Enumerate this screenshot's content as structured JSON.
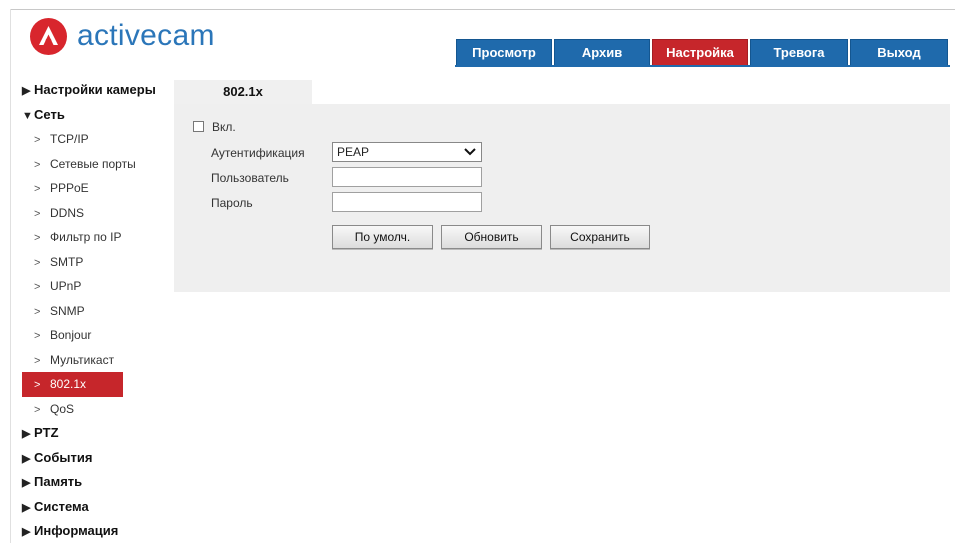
{
  "brand": {
    "name": "activecam",
    "logo_color": "#d8262d",
    "text_color": "#2b76b9"
  },
  "nav": {
    "tabs": [
      {
        "label": "Просмотр",
        "active": false
      },
      {
        "label": "Архив",
        "active": false
      },
      {
        "label": "Настройка",
        "active": true
      },
      {
        "label": "Тревога",
        "active": false
      },
      {
        "label": "Выход",
        "active": false
      }
    ],
    "active_color": "#c6262b",
    "color": "#1f6aac"
  },
  "sidebar": {
    "camera_settings": "Настройки камеры",
    "network": "Сеть",
    "network_items": [
      "TCP/IP",
      "Сетевые порты",
      "PPPoE",
      "DDNS",
      "Фильтр по IP",
      "SMTP",
      "UPnP",
      "SNMP",
      "Bonjour",
      "Мультикаст",
      "802.1x",
      "QoS"
    ],
    "active_item": "802.1x",
    "ptz": "PTZ",
    "events": "События",
    "storage": "Память",
    "system": "Система",
    "info": "Информация"
  },
  "content": {
    "tab": "802.1x",
    "enable_label": "Вкл.",
    "enable_checked": false,
    "auth_label": "Аутентификация",
    "auth_value": "PEAP",
    "user_label": "Пользователь",
    "user_value": "",
    "password_label": "Пароль",
    "password_value": "",
    "buttons": {
      "default": "По умолч.",
      "refresh": "Обновить",
      "save": "Сохранить"
    }
  }
}
